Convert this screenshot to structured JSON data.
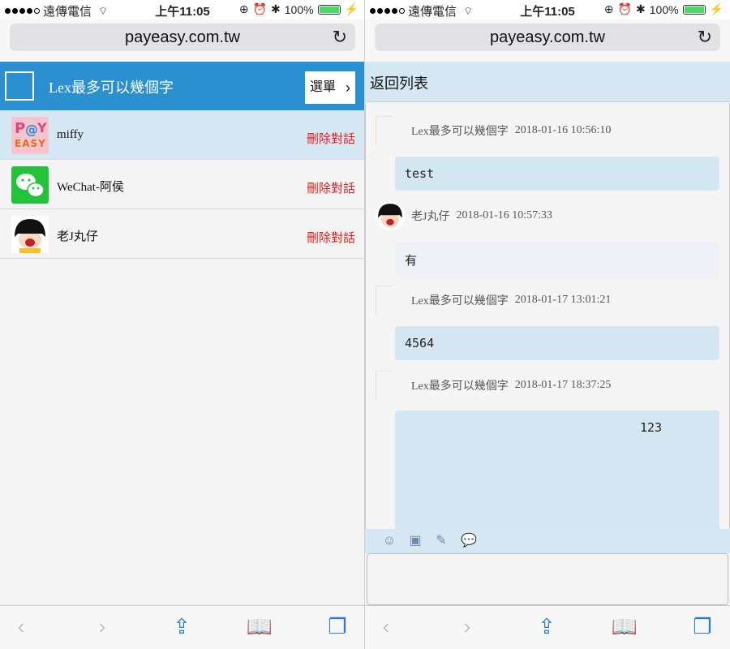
{
  "statusbar": {
    "carrier": "遠傳電信",
    "time": "上午11:05",
    "battery": "100%",
    "battery_level": 1.0
  },
  "browser": {
    "url": "payeasy.com.tw"
  },
  "left": {
    "header_title": "Lex最多可以幾個字",
    "menu_label": "選單",
    "chats": [
      {
        "name": "miffy",
        "delete_label": "刪除對話",
        "avatar": "payeasy-logo"
      },
      {
        "name": "WeChat-阿侯",
        "delete_label": "刪除對話",
        "avatar": "wechat-logo"
      },
      {
        "name": "老J丸仔",
        "delete_label": "刪除對話",
        "avatar": "maruko-face"
      }
    ],
    "avatar_miffy_text": [
      "P",
      "@",
      "Y",
      "EASY"
    ]
  },
  "right": {
    "back_label": "返回列表",
    "messages": [
      {
        "sender": "Lex最多可以幾個字",
        "time": "2018-01-16 10:56:10",
        "text": "test"
      },
      {
        "sender": "老J丸仔",
        "time": "2018-01-16 10:57:33",
        "text": "有"
      },
      {
        "sender": "Lex最多可以幾個字",
        "time": "2018-01-17 13:01:21",
        "text": "4564"
      },
      {
        "sender": "Lex最多可以幾個字",
        "time": "2018-01-17 18:37:25",
        "text": "123"
      }
    ]
  },
  "toolbar": {
    "icons": [
      "back-arrow-icon",
      "forward-arrow-icon",
      "share-icon",
      "bookmarks-icon",
      "tabs-icon"
    ]
  },
  "colors": {
    "header_blue": "#2a90d0",
    "selected_row": "#d6e8f3",
    "delete_red": "#e21d1d",
    "bubble_blue": "#d4e6f2"
  }
}
